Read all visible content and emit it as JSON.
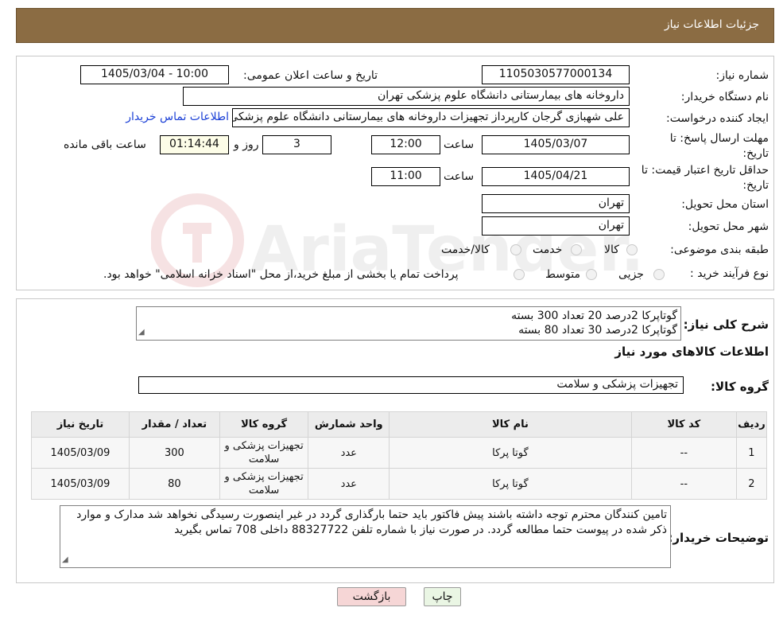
{
  "header": {
    "title": "جزئیات اطلاعات نیاز"
  },
  "fields": {
    "need_number_label": "شماره نیاز:",
    "need_number": "1105030577000134",
    "announce_label": "تاریخ و ساعت اعلان عمومی:",
    "announce_value": "1405/03/04 - 10:00",
    "buyer_org_label": "نام دستگاه خریدار:",
    "buyer_org": "داروخانه های بیمارستانی دانشگاه علوم پزشکی تهران",
    "creator_label": "ایجاد کننده درخواست:",
    "creator": "علی شهبازی گرجان کارپرداز تجهیزات داروخانه های بیمارستانی دانشگاه علوم پزشکی تهران",
    "contact_link": "اطلاعات تماس خریدار",
    "deadline_label": "مهلت ارسال پاسخ: تا تاریخ:",
    "deadline_date": "1405/03/07",
    "time_label": "ساعت",
    "deadline_time": "12:00",
    "days_value": "3",
    "days_label": "روز و",
    "remaining_time": "01:14:44",
    "remaining_label": "ساعت باقی مانده",
    "validity_label": "حداقل تاریخ اعتبار قیمت: تا تاریخ:",
    "validity_date": "1405/04/21",
    "validity_time": "11:00",
    "province_label": "استان محل تحویل:",
    "province": "تهران",
    "city_label": "شهر محل تحویل:",
    "city": "تهران",
    "category_label": "طبقه بندی موضوعی:",
    "category_options": [
      "کالا",
      "خدمت",
      "کالا/خدمت"
    ],
    "process_label": "نوع فرآیند خرید :",
    "process_options": [
      "جزیی",
      "متوسط"
    ],
    "process_note": "پرداخت تمام یا بخشی از مبلغ خرید،از محل \"اسناد خزانه اسلامی\" خواهد بود."
  },
  "summary": {
    "label": "شرح کلی نیاز:",
    "lines": [
      "گوتاپرکا 2درصد 20 تعداد 300 بسته",
      "گوتاپرکا 2درصد 30 تعداد 80 بسته"
    ],
    "goods_info_title": "اطلاعات کالاهای مورد نیاز",
    "group_label": "گروه کالا:",
    "group_value": "تجهیزات پزشکی و سلامت"
  },
  "table": {
    "headers": [
      "ردیف",
      "کد کالا",
      "نام کالا",
      "واحد شمارش",
      "گروه کالا",
      "تعداد / مقدار",
      "تاریخ نیاز"
    ],
    "rows": [
      [
        "1",
        "--",
        "گوتا پرکا",
        "عدد",
        "تجهیزات پزشکی و سلامت",
        "300",
        "1405/03/09"
      ],
      [
        "2",
        "--",
        "گوتا پرکا",
        "عدد",
        "تجهیزات پزشکی و سلامت",
        "80",
        "1405/03/09"
      ]
    ]
  },
  "buyer_notes": {
    "label": "توضیحات خریدار:",
    "text": "تامین کنندگان محترم توجه داشته باشند پیش فاکتور باید حتما بارگذاری گردد در غیر اینصورت رسیدگی نخواهد شد مدارک و موارد ذکر شده در پیوست حتما مطالعه گردد. در صورت نیاز با شماره تلفن 88327722 داخلی 708 تماس بگیرید"
  },
  "buttons": {
    "back": "بازگشت",
    "print": "چاپ"
  },
  "watermark": {
    "text": "AriaTender.neT"
  },
  "colors": {
    "header_bg": "#8b6c43",
    "back_button_bg": "#f6d6d6",
    "print_button_bg": "#eaf6e4",
    "link": "#1a3fd6"
  }
}
